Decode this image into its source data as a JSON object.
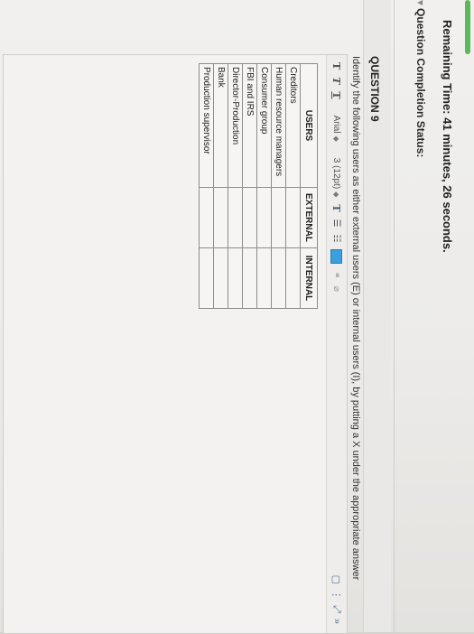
{
  "timer": {
    "prefix": "Remaining Time: ",
    "minutes": "41",
    "minutes_unit": " minutes, ",
    "seconds": "26",
    "seconds_unit": " seconds."
  },
  "status": {
    "label": "Question Completion Status:"
  },
  "question": {
    "title": "QUESTION 9",
    "prompt": "Identify the following users as either external users (E) or internal users (I), by putting a X under the appropriate answer"
  },
  "table": {
    "headers": {
      "users": "USERS",
      "external": "EXTERNAL",
      "internal": "INTERNAL"
    },
    "rows": [
      "Creditors",
      "Human resource managers",
      "Consumer group",
      "FBI and IRS",
      "Director-Production",
      "Bank",
      "Production supervisor"
    ]
  },
  "toolbar": {
    "text_style_1": "T",
    "text_style_2": "T",
    "text_style_3": "T",
    "font": "Arial",
    "size": "3 (12pt)",
    "text_color": "T",
    "colors": {
      "accent": "#5cb85c",
      "highlight": "#3aa0dd"
    }
  }
}
